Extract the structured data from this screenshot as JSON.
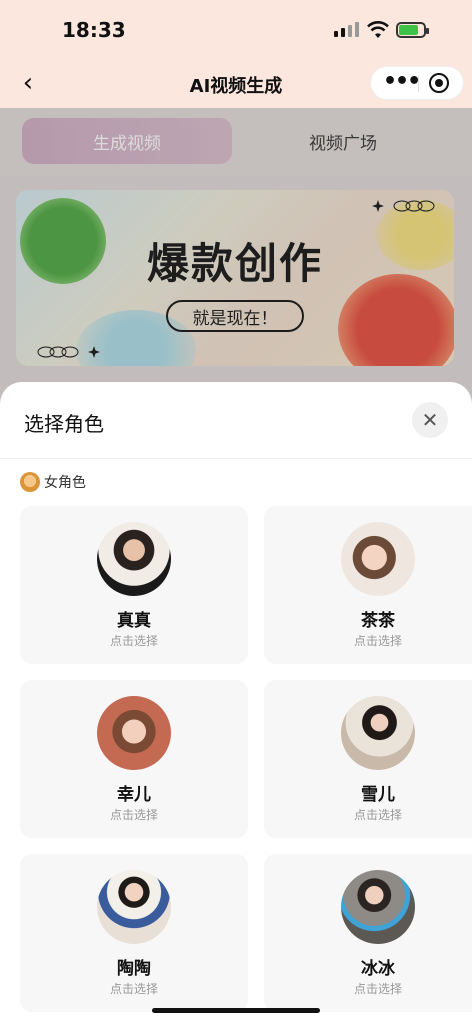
{
  "status_bar": {
    "time": "18:33",
    "battery_level": 0.8
  },
  "nav": {
    "title": "AI视频生成",
    "more_icon": "more-dots-icon",
    "close_icon": "mini-program-close-icon"
  },
  "tabs": [
    {
      "label": "生成视频",
      "active": true
    },
    {
      "label": "视频广场",
      "active": false
    }
  ],
  "banner": {
    "headline": "爆款创作",
    "pill": "就是现在！"
  },
  "sheet": {
    "title": "选择角色",
    "close_icon": "close-icon",
    "category": "女角色",
    "characters": [
      {
        "name": "真真",
        "hint": "点击选择"
      },
      {
        "name": "茶茶",
        "hint": "点击选择"
      },
      {
        "name": "幸儿",
        "hint": "点击选择"
      },
      {
        "name": "雪儿",
        "hint": "点击选择"
      },
      {
        "name": "陶陶",
        "hint": "点击选择"
      },
      {
        "name": "冰冰",
        "hint": "点击选择"
      }
    ]
  }
}
